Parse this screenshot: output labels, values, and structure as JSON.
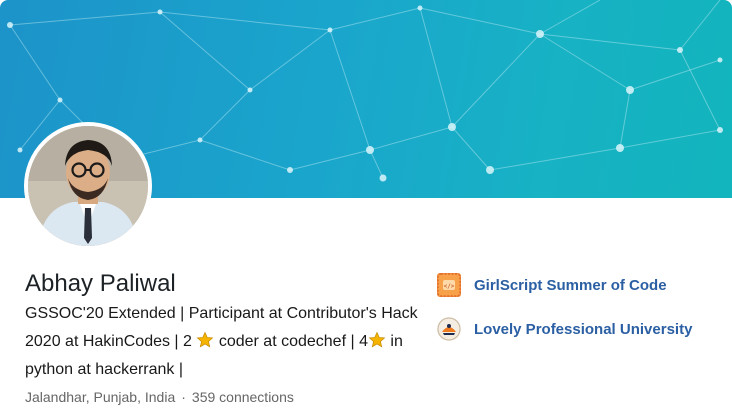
{
  "profile": {
    "name": "Abhay Paliwal",
    "headline": {
      "part1": "GSSOC'20 Extended | Participant at Contributor's Hack 2020 at HakinCodes | 2 ",
      "part2": " coder at codechef | 4",
      "part3": " in python at hackerrank |"
    },
    "location": "Jalandhar, Punjab, India",
    "separator": "·",
    "connections": "359 connections"
  },
  "orgs": [
    {
      "label": "GirlScript Summer of Code",
      "icon": "girlscript-logo-icon"
    },
    {
      "label": "Lovely Professional University",
      "icon": "lpu-logo-icon"
    }
  ],
  "colors": {
    "banner": "#1aa6cc",
    "link": "#2b5fa3",
    "star": "#f5b400"
  }
}
